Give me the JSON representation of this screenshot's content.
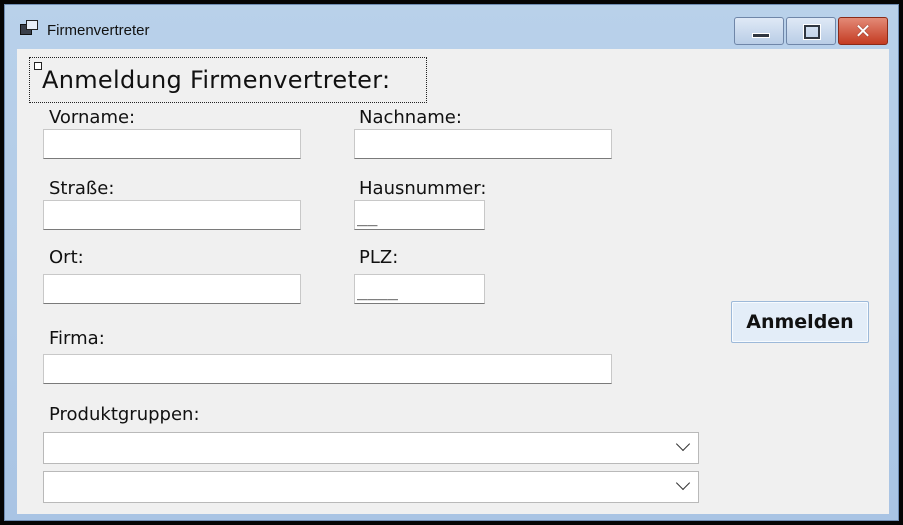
{
  "window": {
    "title": "Firmenvertreter",
    "controls": {
      "minimize_icon": "minimize-icon",
      "maximize_icon": "maximize-icon",
      "close_icon": "close-icon"
    }
  },
  "form": {
    "heading": "Anmeldung Firmenvertreter:",
    "fields": {
      "vorname": {
        "label": "Vorname:",
        "value": ""
      },
      "nachname": {
        "label": "Nachname:",
        "value": ""
      },
      "strasse": {
        "label": "Straße:",
        "value": ""
      },
      "hausnummer": {
        "label": "Hausnummer:",
        "value": "__"
      },
      "ort": {
        "label": "Ort:",
        "value": ""
      },
      "plz": {
        "label": "PLZ:",
        "value": "____"
      },
      "firma": {
        "label": "Firma:",
        "value": ""
      }
    },
    "produktgruppen": {
      "label": "Produktgruppen:",
      "combo1_value": "",
      "combo2_value": ""
    },
    "submit_label": "Anmelden"
  }
}
